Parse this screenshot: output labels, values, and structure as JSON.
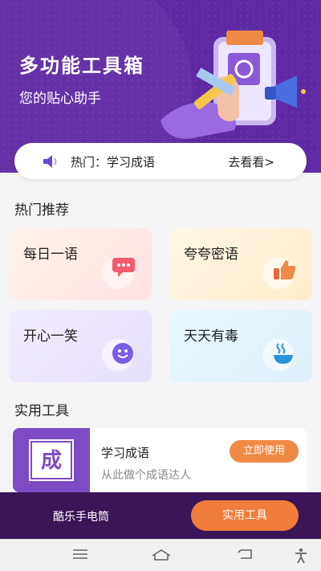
{
  "hero": {
    "title": "多功能工具箱",
    "subtitle": "您的贴心助手"
  },
  "notice": {
    "text": "热门：学习成语",
    "more": "去看看>"
  },
  "hot": {
    "title": "热门推荐",
    "cards": [
      {
        "label": "每日一语",
        "icon": "chat-bubble-icon"
      },
      {
        "label": "夸夸密语",
        "icon": "thumbs-up-icon"
      },
      {
        "label": "开心一笑",
        "icon": "smiley-icon"
      },
      {
        "label": "天天有毒",
        "icon": "steaming-cup-icon"
      }
    ]
  },
  "tools": {
    "title": "实用工具",
    "items": [
      {
        "glyph": "成",
        "name": "学习成语",
        "desc": "从此做个成语达人",
        "button": "立即使用"
      }
    ]
  },
  "tabbar": {
    "left": "酷乐手电筒",
    "right": "实用工具"
  },
  "colors": {
    "primary": "#5e2aa3",
    "accent": "#f07d3c",
    "tabbar": "#3b1558"
  }
}
